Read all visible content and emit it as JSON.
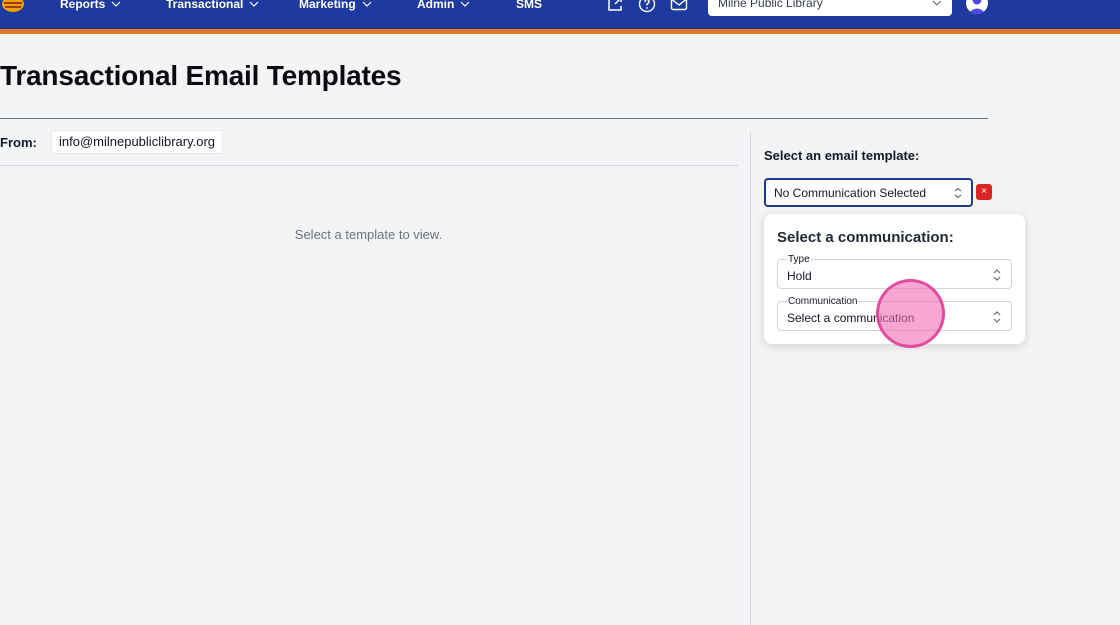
{
  "nav": {
    "items": [
      {
        "label": "Reports",
        "has_dropdown": true
      },
      {
        "label": "Transactional",
        "has_dropdown": true
      },
      {
        "label": "Marketing",
        "has_dropdown": true
      },
      {
        "label": "Admin",
        "has_dropdown": true
      },
      {
        "label": "SMS",
        "has_dropdown": false
      }
    ],
    "icons": [
      "export-icon",
      "help-icon",
      "mail-icon"
    ],
    "library_select": {
      "value": "Milne Public Library"
    },
    "colors": {
      "bar": "#1e3a9f",
      "accent": "#e07b22"
    }
  },
  "page": {
    "title": "Transactional Email Templates",
    "from_label": "From:",
    "from_value": "info@milnepubliclibrary.org",
    "placeholder": "Select a template to view."
  },
  "template_panel": {
    "label": "Select an email template:",
    "selected": "No Communication Selected",
    "clear_label": "×",
    "popover": {
      "title": "Select a communication:",
      "type_label": "Type",
      "type_value": "Hold",
      "communication_label": "Communication",
      "communication_value": "Select a communication"
    }
  }
}
